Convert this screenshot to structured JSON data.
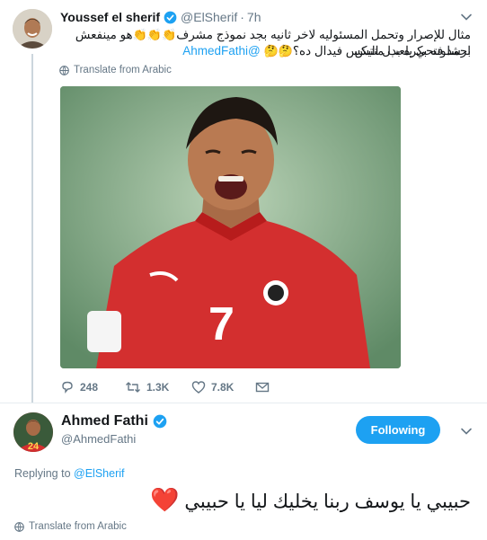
{
  "tweet": {
    "author_name": "Youssef el sherif",
    "author_handle": "@ElSherif",
    "separator": "·",
    "time": "7h",
    "text_line1": "مثال للإصرار وتحمل المسئوليه لاخر ثانيه بجد نموذج مشرف",
    "text_line1_emoji": "👏👏👏",
    "text_line1_tail": "هو مينفعش احمد فتحي يلعب منتش",
    "text_line2_mention": "@AhmedFathi",
    "text_line2_emoji": "🤔🤔",
    "text_line2": "برشلونه بكره بدل اليكس فيدال ده؟",
    "translate_label": "Translate from Arabic",
    "stats": {
      "replies": "248",
      "retweets": "1.3K",
      "likes": "7.8K"
    }
  },
  "reply": {
    "author_name": "Ahmed Fathi",
    "author_handle": "@AhmedFathi",
    "follow_button_label": "Following",
    "replying_to_prefix": "Replying to",
    "replying_to_handle": "@ElSherif",
    "text": "حبيبي يا يوسف ربنا يخليك ليا يا حبيبي",
    "text_emoji": "❤️",
    "translate_label": "Translate from Arabic",
    "jersey_number": "24"
  },
  "photo": {
    "jersey_number": "7"
  },
  "colors": {
    "accent": "#1da1f2",
    "secondary_text": "#657786",
    "divider": "#e6ecf0",
    "jersey_red": "#d32f2f"
  },
  "icons": {
    "verified": "verified-badge-icon",
    "caret": "chevron-down-icon",
    "globe": "globe-icon",
    "reply": "reply-icon",
    "retweet": "retweet-icon",
    "like": "heart-icon",
    "dm": "envelope-icon"
  }
}
